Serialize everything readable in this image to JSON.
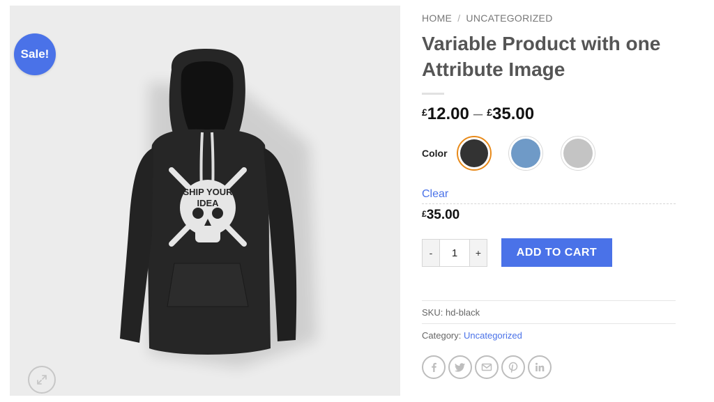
{
  "gallery": {
    "sale_badge": "Sale!",
    "hoodie_color": "#222222",
    "print_text_line1": "SHIP YOUR",
    "print_text_line2": "IDEA"
  },
  "breadcrumb": {
    "home": "HOME",
    "separator": "/",
    "category": "UNCATEGORIZED"
  },
  "product": {
    "title": "Variable Product with one Attribute Image",
    "price_range": {
      "currency": "£",
      "min": "12.00",
      "separator": "–",
      "max": "35.00"
    },
    "color_label": "Color",
    "swatches": [
      {
        "name": "Black",
        "color": "#333333",
        "selected": true
      },
      {
        "name": "Blue",
        "color": "#6f9ac7",
        "selected": false
      },
      {
        "name": "Grey",
        "color": "#c4c4c4",
        "selected": false
      }
    ],
    "clear_label": "Clear",
    "variation_price": {
      "currency": "£",
      "amount": "35.00"
    },
    "quantity": {
      "minus": "-",
      "value": "1",
      "plus": "+"
    },
    "add_to_cart_label": "ADD TO CART",
    "sku": {
      "label": "SKU:",
      "value": "hd-black"
    },
    "category": {
      "label": "Category:",
      "value": "Uncategorized"
    }
  },
  "share": {
    "icons": [
      "facebook-icon",
      "twitter-icon",
      "email-icon",
      "pinterest-icon",
      "linkedin-icon"
    ]
  },
  "colors": {
    "accent": "#4a72e8",
    "selected_border": "#e88a1a"
  }
}
